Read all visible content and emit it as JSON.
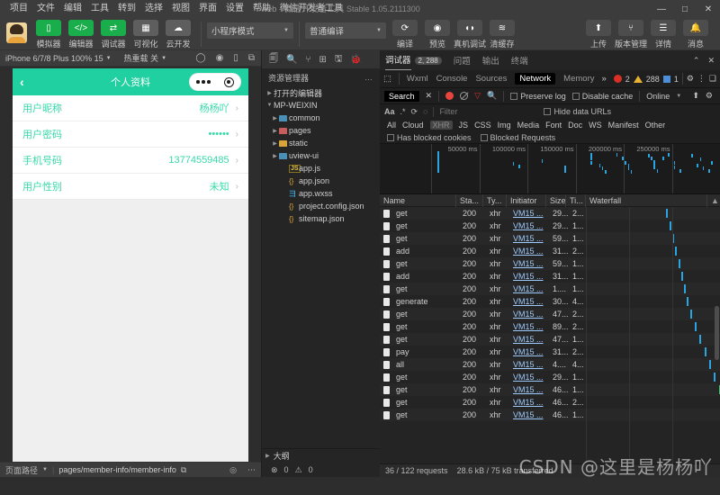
{
  "titlebar": {
    "menus": [
      "项目",
      "文件",
      "编辑",
      "工具",
      "转到",
      "选择",
      "视图",
      "界面",
      "设置",
      "帮助",
      "微信开发者工具"
    ],
    "title": "web - 微信开发者工具",
    "version": "Stable 1.05.2111300",
    "minimize": "—",
    "maximize": "□",
    "close": "✕"
  },
  "toolbar": {
    "buttons": [
      {
        "label": "模拟器",
        "icon": "phone-icon",
        "glyph": "▯",
        "style": "green"
      },
      {
        "label": "编辑器",
        "icon": "code-icon",
        "glyph": "</>",
        "style": "green"
      },
      {
        "label": "调试器",
        "icon": "bug-icon",
        "glyph": "⇄",
        "style": "green"
      },
      {
        "label": "可视化",
        "icon": "layout-icon",
        "glyph": "▦",
        "style": "grey"
      },
      {
        "label": "云开发",
        "icon": "cloud-icon",
        "glyph": "☁",
        "style": "grey"
      }
    ],
    "mode_select": "小程序模式",
    "compile_select": "普通编译",
    "actions": [
      {
        "label": "编译",
        "icon": "refresh-icon",
        "glyph": "⟳"
      },
      {
        "label": "预览",
        "icon": "eye-icon",
        "glyph": "◉"
      },
      {
        "label": "真机调试",
        "icon": "device-debug-icon",
        "glyph": "◖◗"
      },
      {
        "label": "清缓存",
        "icon": "layers-icon",
        "glyph": "≋"
      }
    ],
    "right_actions": [
      {
        "label": "上传",
        "icon": "upload-icon",
        "glyph": "⬆"
      },
      {
        "label": "版本管理",
        "icon": "branch-icon",
        "glyph": "⑂"
      },
      {
        "label": "详情",
        "icon": "detail-icon",
        "glyph": "☰"
      },
      {
        "label": "消息",
        "icon": "bell-icon",
        "glyph": "🔔"
      }
    ]
  },
  "simulator": {
    "device": "iPhone 6/7/8 Plus 100% 15",
    "hot_reload": "热重载 关",
    "toolbar_icons": [
      "refresh-icon",
      "record-icon",
      "rotate-icon",
      "screencast-icon"
    ],
    "nav": {
      "back_icon": "chevron-left-icon",
      "title": "个人资料",
      "capsule_more_icon": "more-dots-icon",
      "capsule_target_icon": "target-circle-icon"
    },
    "rows": [
      {
        "key": "用户昵称",
        "value": "杨杨吖"
      },
      {
        "key": "用户密码",
        "value": "••••••"
      },
      {
        "key": "手机号码",
        "value": "13774559485"
      },
      {
        "key": "用户性别",
        "value": "未知"
      }
    ],
    "footer": {
      "label": "页面路径",
      "path": "pages/member-info/member-info",
      "copy_icon": "copy-icon",
      "eye_icon": "eye-icon",
      "more_icon": "more-icon"
    }
  },
  "explorer": {
    "activity_icons": [
      "files-icon",
      "search-icon",
      "source-control-icon",
      "extensions-icon",
      "save-icon",
      "debug-icon"
    ],
    "header": "资源管理器",
    "header_more": "…",
    "sections": [
      {
        "label": "打开的编辑器",
        "expanded": false
      },
      {
        "label": "MP-WEIXIN",
        "expanded": true
      }
    ],
    "tree": [
      {
        "label": "common",
        "type": "folder",
        "color": "blue"
      },
      {
        "label": "pages",
        "type": "folder",
        "color": "pink"
      },
      {
        "label": "static",
        "type": "folder",
        "color": "yellow"
      },
      {
        "label": "uview-ui",
        "type": "folder",
        "color": "blue"
      },
      {
        "label": "app.js",
        "type": "js"
      },
      {
        "label": "app.json",
        "type": "json"
      },
      {
        "label": "app.wxss",
        "type": "wxss"
      },
      {
        "label": "project.config.json",
        "type": "json"
      },
      {
        "label": "sitemap.json",
        "type": "json"
      }
    ],
    "outline": {
      "label": "大纲",
      "error_count": "0",
      "warn_count": "0"
    }
  },
  "devtools": {
    "panels": [
      {
        "label": "调试器",
        "active": true,
        "badge": "2, 288"
      },
      {
        "label": "问题",
        "active": false
      },
      {
        "label": "输出",
        "active": false
      },
      {
        "label": "终端",
        "active": false
      }
    ],
    "panel_right_icons": [
      "collapse-icon",
      "close-icon"
    ],
    "tabs": [
      "Wxml",
      "Console",
      "Sources",
      "Network",
      "Memory"
    ],
    "active_tab": "Network",
    "tabs_overflow": "»",
    "inspect_icon": "inspect-icon",
    "counts": {
      "errors": "2",
      "warnings": "288",
      "info": "1"
    },
    "tool_icons": [
      "settings-gear-icon",
      "kebab-menu-icon",
      "dock-icon"
    ],
    "toolbar": {
      "search_label": "Search",
      "close_search_icon": "close-icon",
      "record_icon": "record-dot-icon",
      "clear_icon": "clear-icon",
      "filter_icon": "funnel-icon",
      "search_icon": "magnifier-icon",
      "preserve_log": "Preserve log",
      "disable_cache": "Disable cache",
      "throttle": "Online",
      "import_icon": "upload-icon",
      "settings_icon": "gear-icon"
    },
    "filter": {
      "font_icon": "Aa",
      "regex_icon": ".*",
      "reload_icon": "reload-icon",
      "clear2_icon": "clear-icon",
      "placeholder": "Filter",
      "hide_data_urls": "Hide data URLs",
      "types": [
        "All",
        "Cloud",
        "XHR",
        "JS",
        "CSS",
        "Img",
        "Media",
        "Font",
        "Doc",
        "WS",
        "Manifest",
        "Other"
      ],
      "selected_type": "XHR",
      "has_blocked_cookies": "Has blocked cookies",
      "blocked_requests": "Blocked Requests"
    },
    "overview_ticks": [
      "50000 ms",
      "100000 ms",
      "150000 ms",
      "200000 ms",
      "250000 ms"
    ],
    "columns": [
      "Name",
      "Sta...",
      "Ty...",
      "Initiator",
      "Size",
      "Ti...",
      "Waterfall"
    ],
    "sort_icon": "sort-asc-icon",
    "requests": [
      {
        "name": "get",
        "status": "200",
        "type": "xhr",
        "initiator": "VM15 ...",
        "size": "29...",
        "time": "2..."
      },
      {
        "name": "get",
        "status": "200",
        "type": "xhr",
        "initiator": "VM15 ...",
        "size": "29...",
        "time": "1..."
      },
      {
        "name": "get",
        "status": "200",
        "type": "xhr",
        "initiator": "VM15 ...",
        "size": "59...",
        "time": "1..."
      },
      {
        "name": "add",
        "status": "200",
        "type": "xhr",
        "initiator": "VM15 ...",
        "size": "31...",
        "time": "2..."
      },
      {
        "name": "get",
        "status": "200",
        "type": "xhr",
        "initiator": "VM15 ...",
        "size": "59...",
        "time": "1..."
      },
      {
        "name": "add",
        "status": "200",
        "type": "xhr",
        "initiator": "VM15 ...",
        "size": "31...",
        "time": "1..."
      },
      {
        "name": "get",
        "status": "200",
        "type": "xhr",
        "initiator": "VM15 ...",
        "size": "1....",
        "time": "1..."
      },
      {
        "name": "generate",
        "status": "200",
        "type": "xhr",
        "initiator": "VM15 ...",
        "size": "30...",
        "time": "4..."
      },
      {
        "name": "get",
        "status": "200",
        "type": "xhr",
        "initiator": "VM15 ...",
        "size": "47...",
        "time": "2..."
      },
      {
        "name": "get",
        "status": "200",
        "type": "xhr",
        "initiator": "VM15 ...",
        "size": "89...",
        "time": "2..."
      },
      {
        "name": "get",
        "status": "200",
        "type": "xhr",
        "initiator": "VM15 ...",
        "size": "47...",
        "time": "1..."
      },
      {
        "name": "pay",
        "status": "200",
        "type": "xhr",
        "initiator": "VM15 ...",
        "size": "31...",
        "time": "2..."
      },
      {
        "name": "all",
        "status": "200",
        "type": "xhr",
        "initiator": "VM15 ...",
        "size": "4....",
        "time": "4..."
      },
      {
        "name": "get",
        "status": "200",
        "type": "xhr",
        "initiator": "VM15 ...",
        "size": "29...",
        "time": "1..."
      },
      {
        "name": "get",
        "status": "200",
        "type": "xhr",
        "initiator": "VM15 ...",
        "size": "46...",
        "time": "1..."
      },
      {
        "name": "get",
        "status": "200",
        "type": "xhr",
        "initiator": "VM15 ...",
        "size": "46...",
        "time": "2..."
      },
      {
        "name": "get",
        "status": "200",
        "type": "xhr",
        "initiator": "VM15 ...",
        "size": "46...",
        "time": "1..."
      }
    ],
    "footer": {
      "requests": "36 / 122 requests",
      "transferred": "28.6 kB / 75 kB transferred"
    }
  },
  "watermark": "CSDN @这里是杨杨吖",
  "colors": {
    "wechat_green": "#1aad4b",
    "nav_green": "#21d0a0",
    "accent_blue": "#2aa5e0",
    "error_red": "#d93025",
    "warn_yellow": "#e8b233"
  }
}
